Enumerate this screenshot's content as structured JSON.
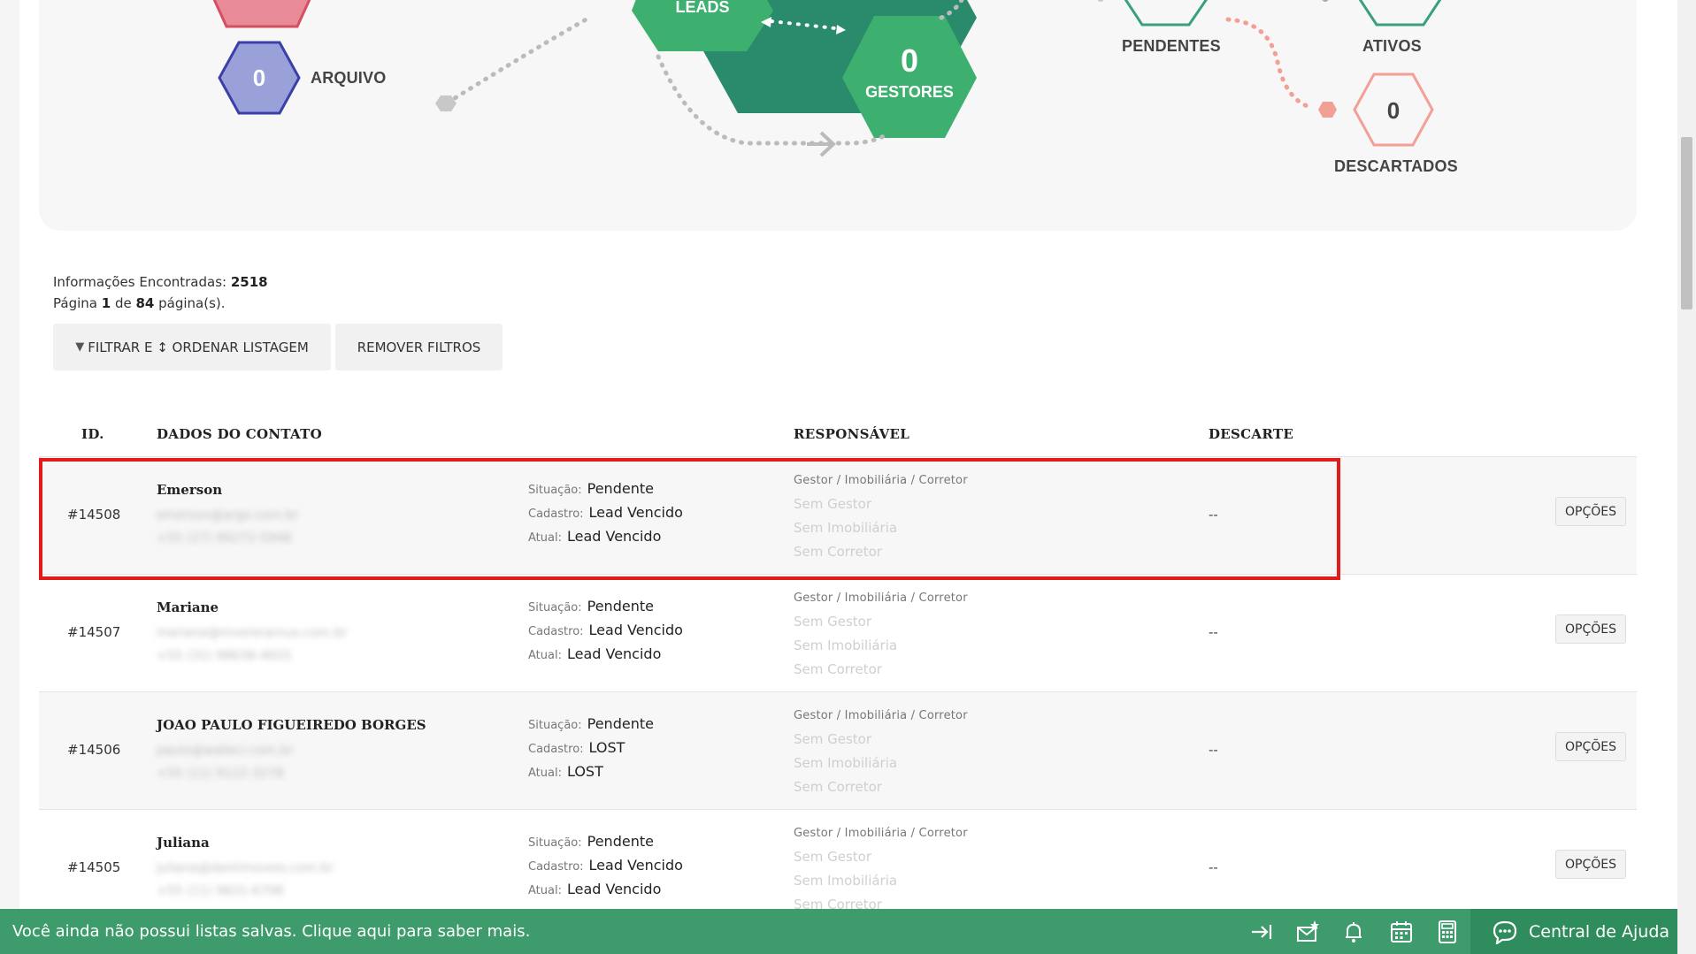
{
  "flow": {
    "arquivo": {
      "count": "0",
      "label": "ARQUIVO"
    },
    "leads": {
      "label": "LEADS"
    },
    "gestores": {
      "count": "0",
      "label": "GESTORES"
    },
    "pendentes": {
      "label": "PENDENTES"
    },
    "ativos": {
      "label": "ATIVOS"
    },
    "descartados": {
      "count": "0",
      "label": "DESCARTADOS"
    }
  },
  "info": {
    "found_label": "Informações Encontradas:",
    "found_count": "2518",
    "page_prefix": "Página",
    "page_current": "1",
    "page_mid": "de",
    "page_total": "84",
    "page_suffix": "página(s)."
  },
  "toolbar": {
    "filter_label": "FILTRAR E ↕ ORDENAR LISTAGEM",
    "remove_label": "REMOVER FILTROS"
  },
  "table": {
    "headers": {
      "id": "ID.",
      "contact": "DADOS DO CONTATO",
      "responsible": "RESPONSÁVEL",
      "discard": "DESCARTE"
    },
    "status_keys": {
      "situacao": "Situação:",
      "cadastro": "Cadastro:",
      "atual": "Atual:"
    },
    "resp_head": "Gestor / Imobiliária / Corretor",
    "resp_gestor": "Sem Gestor",
    "resp_imobiliaria": "Sem Imobiliária",
    "resp_corretor": "Sem Corretor",
    "options_label": "OPÇÕES",
    "rows": [
      {
        "id": "#14508",
        "name": "Emerson",
        "email": "emerson@argo.com.br",
        "phone": "+55 (27) 99272-5948",
        "situacao": "Pendente",
        "cadastro": "Lead Vencido",
        "atual": "Lead Vencido",
        "descarte": "--"
      },
      {
        "id": "#14507",
        "name": "Mariane",
        "email": "mariane@mvererarnus.com.br",
        "phone": "+55 (31) 98638-4655",
        "situacao": "Pendente",
        "cadastro": "Lead Vencido",
        "atual": "Lead Vencido",
        "descarte": "--"
      },
      {
        "id": "#14506",
        "name": "JOAO PAULO FIGUEIREDO BORGES",
        "email": "paulo@walleci.com.br",
        "phone": "+55 (11) 9122-3278",
        "situacao": "Pendente",
        "cadastro": "LOST",
        "atual": "LOST",
        "descarte": "--"
      },
      {
        "id": "#14505",
        "name": "Juliana",
        "email": "juliana@dantimoveis.com.br",
        "phone": "+55 (11) 9831-6798",
        "situacao": "Pendente",
        "cadastro": "Lead Vencido",
        "atual": "Lead Vencido",
        "descarte": "--"
      }
    ]
  },
  "bottom_bar": {
    "message": "Você ainda não possui listas salvas. Clique aqui para saber mais.",
    "help_label": "Central de Ajuda"
  },
  "colors": {
    "green": "#3daf6e",
    "dark_green": "#2a8a6c",
    "purple_hex": "#9aa0d8",
    "purple_border": "#3b3fa8",
    "salmon": "#f2a095",
    "pink": "#e88a97",
    "bar_green": "#3e9b6c",
    "highlight_red": "#e31b1b"
  }
}
